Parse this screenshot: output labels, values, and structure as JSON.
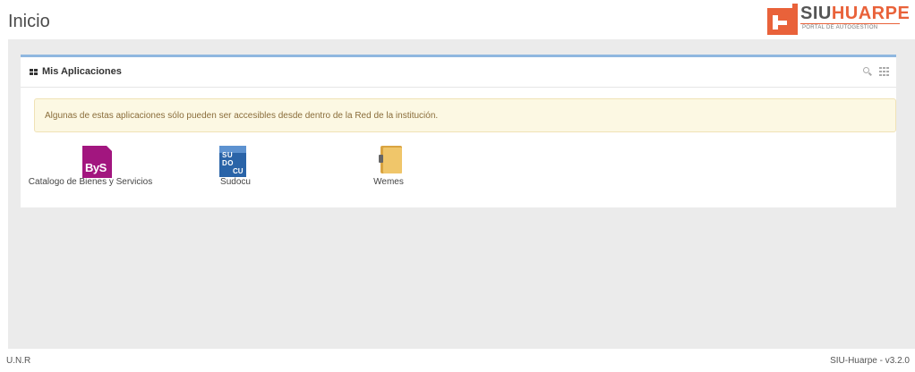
{
  "header": {
    "title": "Inicio",
    "brand": {
      "word_siu": "SIU",
      "word_huarpe": "HUARPE",
      "subtitle": "PORTAL DE AUTOGESTIÓN",
      "color": "#e9623a"
    }
  },
  "panel": {
    "title": "Mis Aplicaciones",
    "accent_color": "#8fb7e0",
    "icons": [
      "grid-icon",
      "search-icon",
      "apps-grid-icon"
    ],
    "alert": "Algunas de estas aplicaciones sólo pueden ser accesibles desde dentro de la Red de la institución.",
    "apps": [
      {
        "name": "Catalogo de Bienes y Servicios",
        "icon_text": "ByS",
        "icon": "bys-app-icon",
        "color": "#a2167f"
      },
      {
        "name": "Sudocu",
        "icon_text_1": "SU",
        "icon_text_2": "DO",
        "icon_text_3": "CU",
        "icon": "sudocu-app-icon",
        "color": "#2a64a8"
      },
      {
        "name": "Wemes",
        "icon": "folder-app-icon",
        "color": "#f0c66a"
      }
    ]
  },
  "footer": {
    "left": "U.N.R",
    "right": "SIU-Huarpe - v3.2.0"
  }
}
